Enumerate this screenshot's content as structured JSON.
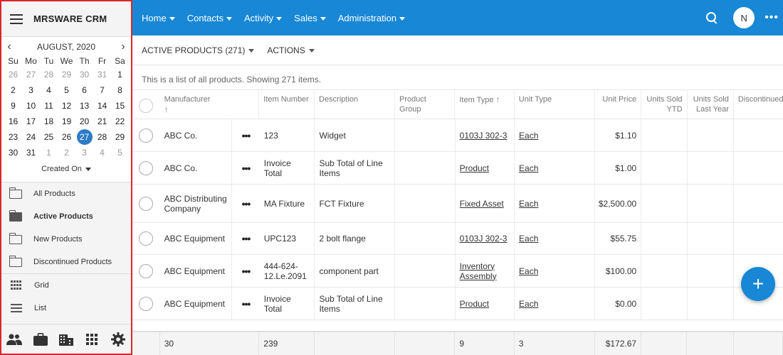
{
  "app": {
    "title": "MRSWARE CRM"
  },
  "calendar": {
    "month_label": "AUGUST, 2020",
    "days_of_week": [
      "Su",
      "Mo",
      "Tu",
      "We",
      "Th",
      "Fr",
      "Sa"
    ],
    "weeks": [
      [
        {
          "d": "26",
          "m": true
        },
        {
          "d": "27",
          "m": true
        },
        {
          "d": "28",
          "m": true
        },
        {
          "d": "29",
          "m": true
        },
        {
          "d": "30",
          "m": true
        },
        {
          "d": "31",
          "m": true
        },
        {
          "d": "1"
        }
      ],
      [
        {
          "d": "2"
        },
        {
          "d": "3"
        },
        {
          "d": "4"
        },
        {
          "d": "5"
        },
        {
          "d": "6"
        },
        {
          "d": "7"
        },
        {
          "d": "8"
        }
      ],
      [
        {
          "d": "9"
        },
        {
          "d": "10"
        },
        {
          "d": "11"
        },
        {
          "d": "12"
        },
        {
          "d": "13"
        },
        {
          "d": "14"
        },
        {
          "d": "15"
        }
      ],
      [
        {
          "d": "16"
        },
        {
          "d": "17"
        },
        {
          "d": "18"
        },
        {
          "d": "19"
        },
        {
          "d": "20"
        },
        {
          "d": "21"
        },
        {
          "d": "22"
        }
      ],
      [
        {
          "d": "23"
        },
        {
          "d": "24"
        },
        {
          "d": "25"
        },
        {
          "d": "26"
        },
        {
          "d": "27",
          "today": true
        },
        {
          "d": "28"
        },
        {
          "d": "29"
        }
      ],
      [
        {
          "d": "30"
        },
        {
          "d": "31"
        },
        {
          "d": "1",
          "m": true
        },
        {
          "d": "2",
          "m": true
        },
        {
          "d": "3",
          "m": true
        },
        {
          "d": "4",
          "m": true
        },
        {
          "d": "5",
          "m": true
        }
      ]
    ],
    "date_field_label": "Created On"
  },
  "folders": {
    "all": "All Products",
    "active": "Active Products",
    "new": "New Products",
    "discontinued": "Discontinued Products"
  },
  "views": {
    "grid": "Grid",
    "list": "List"
  },
  "nav": {
    "home": "Home",
    "contacts": "Contacts",
    "activity": "Activity",
    "sales": "Sales",
    "administration": "Administration",
    "avatar_initial": "N"
  },
  "toolbar": {
    "view_label": "ACTIVE PRODUCTS (271)",
    "actions_label": "ACTIONS"
  },
  "info_text": "This is a list of all products. Showing 271 items.",
  "table": {
    "headers": {
      "manufacturer": "Manufacturer",
      "item_number": "Item Number",
      "description": "Description",
      "product_group": "Product Group",
      "item_type": "Item Type",
      "unit_type": "Unit Type",
      "unit_price": "Unit Price",
      "units_sold_ytd": "Units Sold YTD",
      "units_sold_last_year": "Units Sold Last Year",
      "discontinued": "Discontinued"
    },
    "rows": [
      {
        "manufacturer": "ABC Co.",
        "item_number": "123",
        "description": "Widget",
        "product_group": "",
        "item_type": "0103J 302-3",
        "unit_type": "Each",
        "unit_price": "$1.10"
      },
      {
        "manufacturer": "ABC Co.",
        "item_number": "Invoice Total",
        "description": "Sub Total of Line Items",
        "product_group": "",
        "item_type": "Product",
        "unit_type": "Each",
        "unit_price": "$1.00"
      },
      {
        "manufacturer": "ABC Distributing Company",
        "item_number": "MA Fixture",
        "description": "FCT Fixture",
        "product_group": "",
        "item_type": "Fixed Asset",
        "unit_type": "Each",
        "unit_price": "$2,500.00"
      },
      {
        "manufacturer": "ABC Equipment",
        "item_number": "UPC123",
        "description": "2 bolt flange",
        "product_group": "",
        "item_type": "0103J 302-3",
        "unit_type": "Each",
        "unit_price": "$55.75"
      },
      {
        "manufacturer": "ABC Equipment",
        "item_number": "444-624-12.Le.2091",
        "description": "component part",
        "product_group": "",
        "item_type": "Inventory Assembly",
        "unit_type": "Each",
        "unit_price": "$100.00"
      },
      {
        "manufacturer": "ABC Equipment",
        "item_number": "Invoice Total",
        "description": "Sub Total of Line Items",
        "product_group": "",
        "item_type": "Product",
        "unit_type": "Each",
        "unit_price": "$0.00"
      }
    ],
    "totals": {
      "manufacturer": "30",
      "item_number": "239",
      "item_type": "9",
      "unit_type": "3",
      "unit_price": "$172.67"
    }
  },
  "icons": {
    "fab": "plus-icon",
    "footer": [
      "people-icon",
      "briefcase-icon",
      "building-icon",
      "apps-icon",
      "settings-icon"
    ]
  },
  "colors": {
    "primary": "#1787d6",
    "today": "#2b7bc6",
    "sidebar_border": "#d9262b"
  }
}
